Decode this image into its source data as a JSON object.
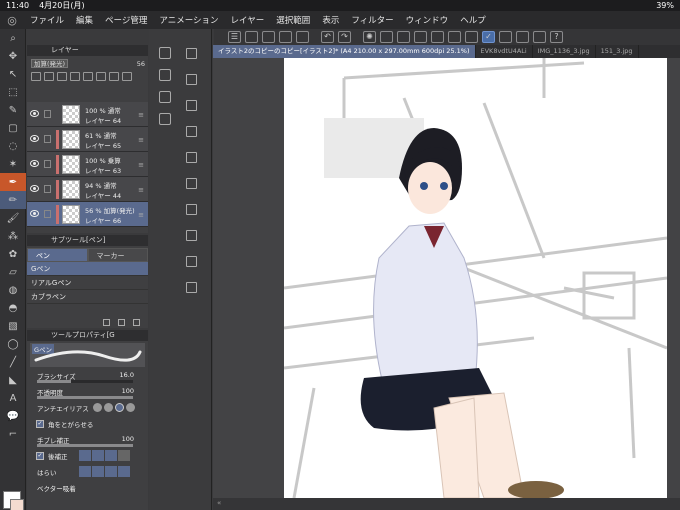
{
  "status": {
    "time": "11:40",
    "date": "4月20日(月)",
    "battery": "39%"
  },
  "menu": [
    "ファイル",
    "編集",
    "ページ管理",
    "アニメーション",
    "レイヤー",
    "選択範囲",
    "表示",
    "フィルター",
    "ウィンドウ",
    "ヘルプ"
  ],
  "layer_panel": {
    "tab": "レイヤー",
    "blend_mode": "加算(発光)",
    "opacity": "56",
    "layers": [
      {
        "mode": "100 % 通常",
        "name": "レイヤー 64",
        "active": false,
        "clip": false
      },
      {
        "mode": "61 % 通常",
        "name": "レイヤー 65",
        "active": false,
        "clip": true
      },
      {
        "mode": "100 % 乗算",
        "name": "レイヤー 63",
        "active": false,
        "clip": true
      },
      {
        "mode": "94 % 通常",
        "name": "レイヤー 44",
        "active": false,
        "clip": true
      },
      {
        "mode": "56 % 加算(発光)",
        "name": "レイヤー 66",
        "active": true,
        "clip": true
      }
    ]
  },
  "subtool": {
    "tab": "サブツール[ペン]",
    "groups": [
      "ペン",
      "マーカー"
    ],
    "items": [
      "Gペン",
      "リアルGペン",
      "カブラペン"
    ]
  },
  "tool_property": {
    "tab": "ツールプロパティ[G",
    "brush_name": "Gペン",
    "brush_size_label": "ブラシサイズ",
    "brush_size": "16.0",
    "opacity_label": "不透明度",
    "opacity": "100",
    "antialias_label": "アンチエイリアス",
    "sharpen_label": "角をとがらせる",
    "stabilize_label": "手ブレ補正",
    "stabilize": "100",
    "post_correct_label": "後補正",
    "smooth_label": "はらい",
    "vector_label": "ベクター吸着"
  },
  "doc_tabs": [
    "イラスト2のコピーのコピー[イラスト2]* (A4 210.00 x 297.00mm 600dpi 25.1%)",
    "EVK8vdtU4ALi",
    "IMG_1136_3.jpg",
    "151_3.jpg"
  ],
  "colors": {
    "accent": "#5a6a8e",
    "active_tool": "#c8572a"
  }
}
